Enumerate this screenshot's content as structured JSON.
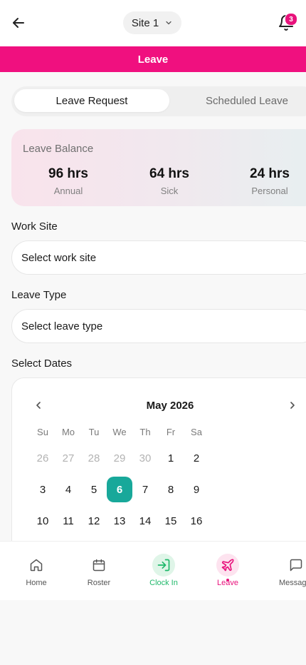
{
  "header": {
    "site_label": "Site 1",
    "notification_count": "3"
  },
  "page_title": "Leave",
  "tabs": [
    {
      "label": "Leave Request",
      "active": true
    },
    {
      "label": "Scheduled Leave",
      "active": false
    }
  ],
  "balance": {
    "title": "Leave Balance",
    "items": [
      {
        "value": "96 hrs",
        "label": "Annual"
      },
      {
        "value": "64 hrs",
        "label": "Sick"
      },
      {
        "value": "24 hrs",
        "label": "Personal"
      }
    ]
  },
  "form": {
    "work_site_label": "Work Site",
    "work_site_placeholder": "Select work site",
    "leave_type_label": "Leave Type",
    "leave_type_placeholder": "Select leave type",
    "dates_label": "Select Dates"
  },
  "calendar": {
    "month": "May 2026",
    "weekdays": [
      "Su",
      "Mo",
      "Tu",
      "We",
      "Th",
      "Fr",
      "Sa"
    ],
    "weeks": [
      [
        {
          "d": "26",
          "muted": true
        },
        {
          "d": "27",
          "muted": true
        },
        {
          "d": "28",
          "muted": true
        },
        {
          "d": "29",
          "muted": true
        },
        {
          "d": "30",
          "muted": true
        },
        {
          "d": "1"
        },
        {
          "d": "2"
        }
      ],
      [
        {
          "d": "3"
        },
        {
          "d": "4"
        },
        {
          "d": "5"
        },
        {
          "d": "6",
          "selected": true
        },
        {
          "d": "7"
        },
        {
          "d": "8"
        },
        {
          "d": "9"
        }
      ],
      [
        {
          "d": "10"
        },
        {
          "d": "11"
        },
        {
          "d": "12"
        },
        {
          "d": "13"
        },
        {
          "d": "14"
        },
        {
          "d": "15"
        },
        {
          "d": "16"
        }
      ]
    ],
    "selected_color": "#18a89a"
  },
  "bottom_nav": [
    {
      "label": "Home",
      "icon": "home-icon",
      "active": false
    },
    {
      "label": "Roster",
      "icon": "calendar-icon",
      "active": false
    },
    {
      "label": "Clock In",
      "icon": "clock-in-icon",
      "active": false
    },
    {
      "label": "Leave",
      "icon": "plane-icon",
      "active": true
    },
    {
      "label": "Messages",
      "icon": "message-icon",
      "active": false
    }
  ],
  "colors": {
    "brand_pink": "#f0107f",
    "clock_in_green": "#1fb86a",
    "teal": "#18a89a"
  }
}
